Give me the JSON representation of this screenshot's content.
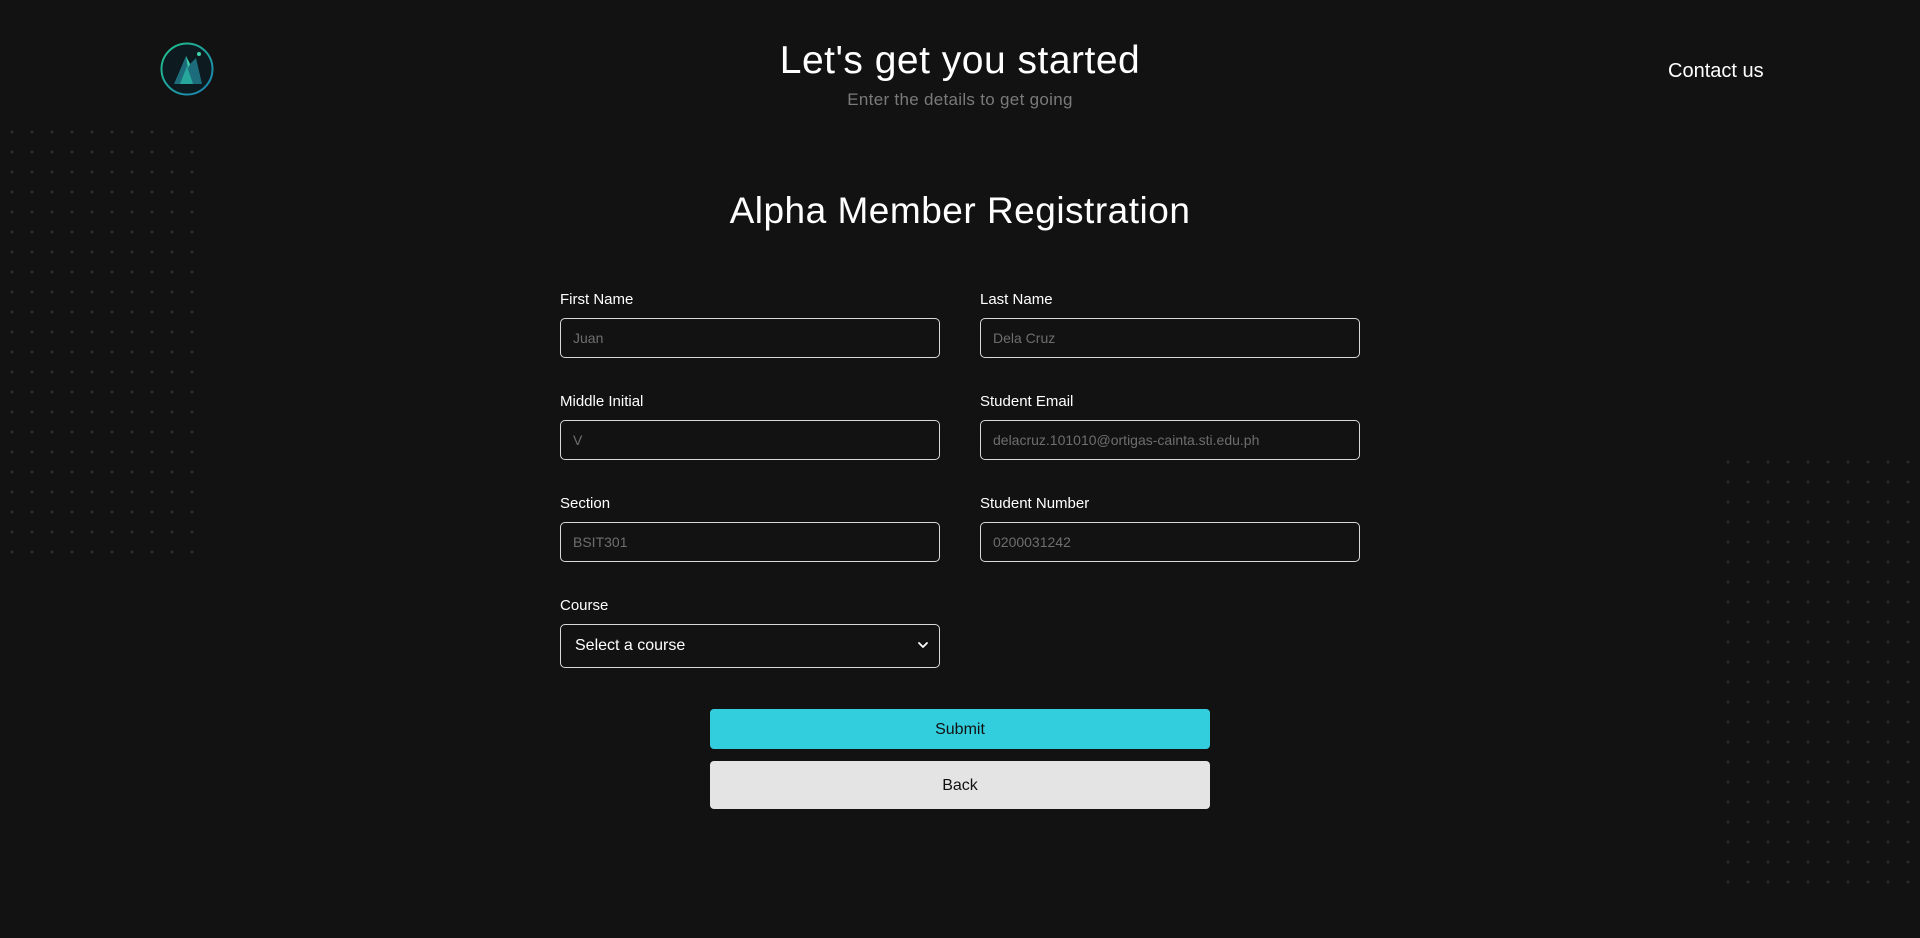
{
  "header": {
    "title": "Let's get you started",
    "subtitle": "Enter the details to get going",
    "contact_label": "Contact us",
    "logo_icon": "alpha-logo-icon"
  },
  "form": {
    "title": "Alpha Member Registration",
    "fields": {
      "first_name": {
        "label": "First Name",
        "placeholder": "Juan",
        "value": ""
      },
      "last_name": {
        "label": "Last Name",
        "placeholder": "Dela Cruz",
        "value": ""
      },
      "middle_initial": {
        "label": "Middle Initial",
        "placeholder": "V",
        "value": ""
      },
      "student_email": {
        "label": "Student Email",
        "placeholder": "delacruz.101010@ortigas-cainta.sti.edu.ph",
        "value": ""
      },
      "section": {
        "label": "Section",
        "placeholder": "BSIT301",
        "value": ""
      },
      "student_number": {
        "label": "Student Number",
        "placeholder": "0200031242",
        "value": ""
      },
      "course": {
        "label": "Course",
        "selected": "Select a course"
      }
    },
    "submit_label": "Submit",
    "back_label": "Back"
  },
  "colors": {
    "background": "#121212",
    "accent": "#33cede",
    "secondary_button": "#e4e4e4"
  }
}
